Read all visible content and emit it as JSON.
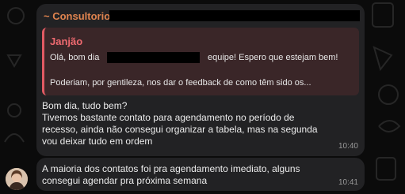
{
  "chat": {
    "group_name": "~ Consultorio",
    "reply": {
      "author": "Janjão",
      "line1_start": "Olá, bom dia",
      "line1_end": "equipe! Espero que estejam bem!",
      "line2": "Poderiam, por gentileza, nos dar o feedback de como têm sido os..."
    },
    "message1": {
      "lines": [
        "Bom dia, tudo bem?",
        "Tivemos bastante contato para agendamento no período de",
        "recesso, ainda não consegui organizar a tabela, mas na segunda",
        "vou deixar tudo em ordem"
      ],
      "time": "10:40"
    },
    "message2": {
      "lines": [
        "A maioria dos contatos foi pra agendamento imediato, alguns",
        "consegui agendar pra próxima semana"
      ],
      "time": "10:41"
    }
  }
}
